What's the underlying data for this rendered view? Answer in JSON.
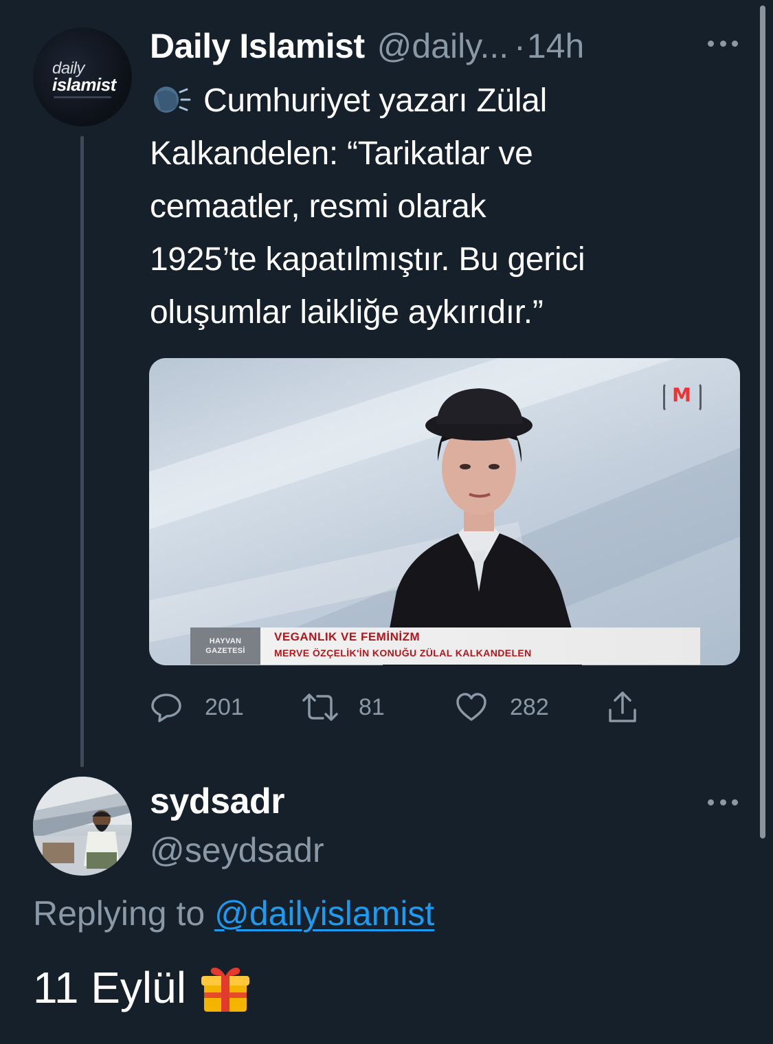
{
  "colors": {
    "background": "#15202b",
    "secondary_text": "#8b98a5",
    "link": "#1d9bf0",
    "primary_text": "#ffffff"
  },
  "original_tweet": {
    "avatar": {
      "icon": "daily-islamist-logo",
      "logo_line1": "daily",
      "logo_line2": "islamist"
    },
    "display_name": "Daily Islamist",
    "handle": "@daily...",
    "time": "14h",
    "separator": "·",
    "emoji_icon": "speaking-head-icon",
    "text_line1": "Cumhuriyet yazarı Zülal",
    "text_line2": "Kalkandelen: “Tarikatlar ve",
    "text_line3": "cemaatler, resmi olarak",
    "text_line4": "1925’te kapatılmıştır. Bu gerici",
    "text_line5": "oluşumlar laikliğe aykırıdır.”",
    "media": {
      "channel_logo": "M",
      "lower_third_left_line1": "HAYVAN",
      "lower_third_left_line2": "GAZETESİ",
      "lower_third_title": "VEGANLIK VE FEMİNİZM",
      "lower_third_subtitle": "MERVE ÖZÇELİK'İN KONUĞU ZÜLAL KALKANDELEN"
    },
    "actions": {
      "replies": "201",
      "retweets": "81",
      "likes": "282"
    }
  },
  "reply_tweet": {
    "display_name": "sydsadr",
    "handle": "@seydsadr",
    "replying_prefix": "Replying to",
    "replying_to": "@dailyislamist",
    "body": "11 Eylül",
    "emoji_icon": "wrapped-gift-icon"
  }
}
